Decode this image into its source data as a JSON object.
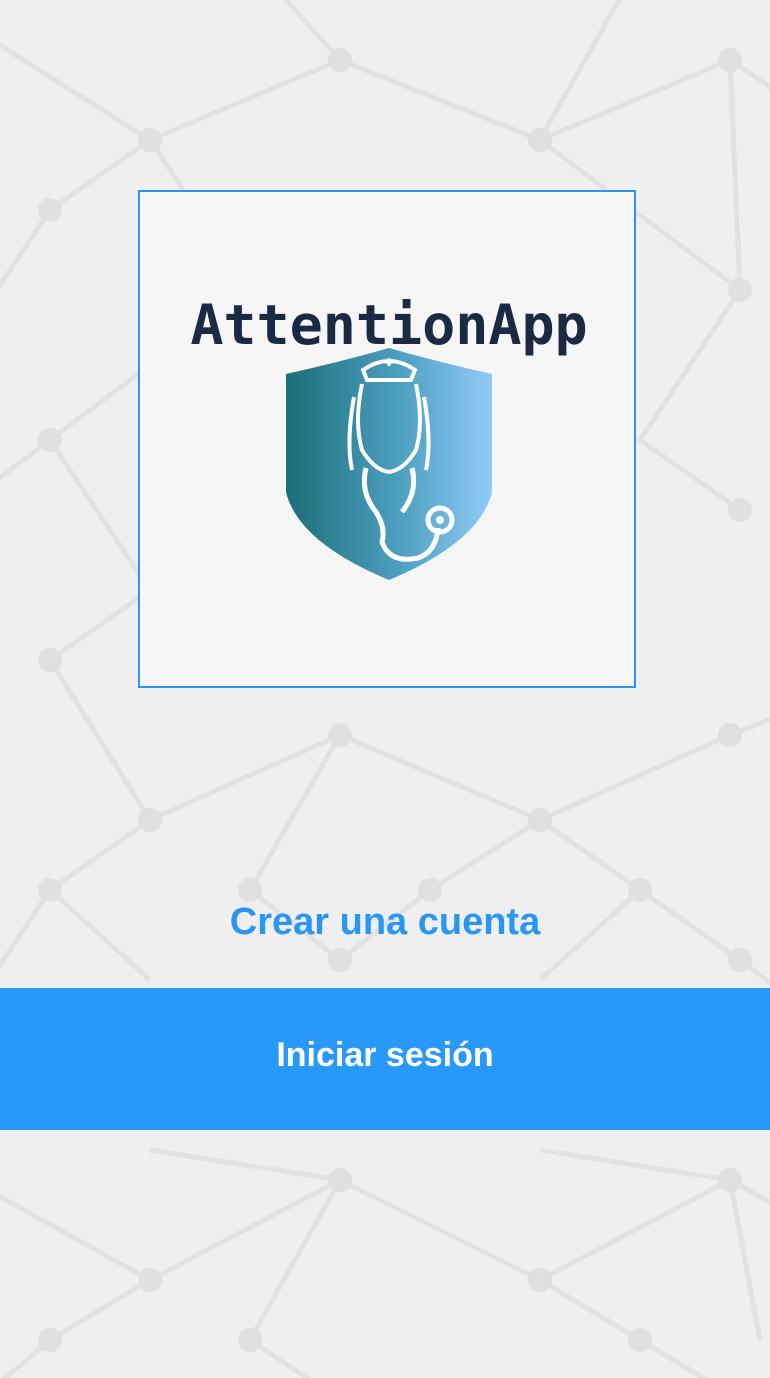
{
  "logo": {
    "brand_text": "AttentionApp",
    "icon": "shield-nurse-stethoscope-icon"
  },
  "actions": {
    "create_account_label": "Crear una cuenta",
    "login_label": "Iniciar sesión"
  },
  "colors": {
    "accent": "#2899fb",
    "link": "#2896f3",
    "background": "#efefef",
    "logo_text": "#1b2a44",
    "shield_dark": "#1c6e78",
    "shield_light": "#89c8f4"
  }
}
